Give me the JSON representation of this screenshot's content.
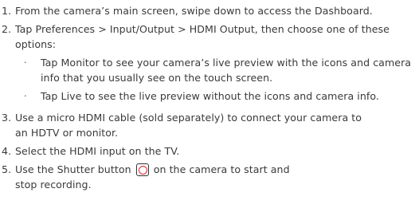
{
  "steps": [
    {
      "number": "1.",
      "text": "From the camera’s main screen, swipe down to access the Dashboard."
    },
    {
      "number": "2.",
      "text": "Tap Preferences > Input/Output > HDMI Output, then choose one of these options:",
      "options": [
        {
          "bullet": "·",
          "text": "Tap Monitor to see your camera’s live preview with the icons and camera info that you usually see on the touch screen."
        },
        {
          "bullet": "·",
          "text": "Tap Live to see the live preview without the icons and camera info."
        }
      ]
    },
    {
      "number": "3.",
      "text": "Use a micro HDMI cable (sold separately) to connect your camera to an HDTV or monitor."
    },
    {
      "number": "4.",
      "text": "Select the HDMI input on the TV."
    },
    {
      "number": "5.",
      "text_before_icon": "Use the Shutter button",
      "icon": "shutter-button-icon",
      "text_after_icon": "on the camera to start and",
      "text_line2": "stop recording."
    }
  ],
  "colors": {
    "text": "#3a3a3a",
    "shutter_icon_ring": "#e0242b"
  }
}
